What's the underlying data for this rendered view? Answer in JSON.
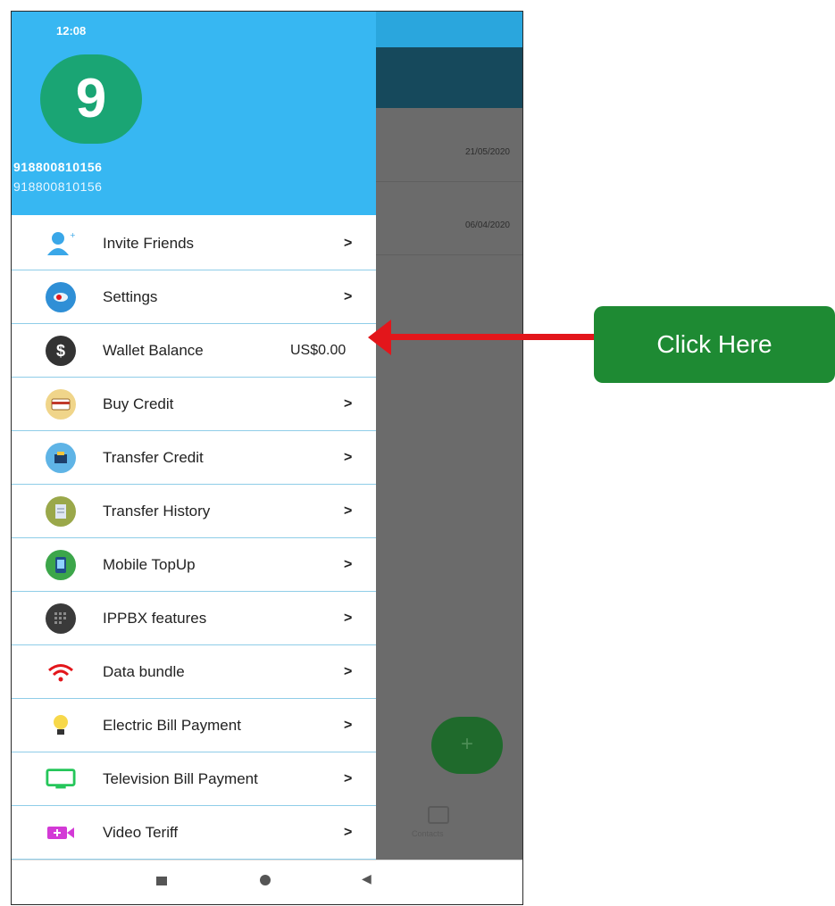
{
  "status_bar": {
    "time": "12:08",
    "icons": "⁴⁄ᵢₗ ▭"
  },
  "profile": {
    "avatar_letter": "9",
    "name": "918800810156",
    "number": "918800810156"
  },
  "background": {
    "dates": [
      "21/05/2020",
      "06/04/2020"
    ],
    "fab_icon": "+",
    "bottom_tab": "Contacts"
  },
  "menu": [
    {
      "label": "Invite Friends",
      "trail": ">",
      "icon": "add-person-icon",
      "color": "#3aa7e8"
    },
    {
      "label": "Settings",
      "trail": ">",
      "icon": "settings-icon",
      "color": "#2f8fd6"
    },
    {
      "label": "Wallet Balance",
      "trail": "US$0.00",
      "icon": "dollar-icon",
      "color": "#333333"
    },
    {
      "label": "Buy Credit",
      "trail": ">",
      "icon": "credit-card-icon",
      "color": "#c99a38"
    },
    {
      "label": "Transfer Credit",
      "trail": ">",
      "icon": "transfer-icon",
      "color": "#2a79c2"
    },
    {
      "label": "Transfer History",
      "trail": ">",
      "icon": "history-icon",
      "color": "#8a9a3a"
    },
    {
      "label": "Mobile TopUp",
      "trail": ">",
      "icon": "mobile-icon",
      "color": "#3ca64a"
    },
    {
      "label": "IPPBX features",
      "trail": ">",
      "icon": "ippbx-icon",
      "color": "#3a3a3a"
    },
    {
      "label": "Data bundle",
      "trail": ">",
      "icon": "wifi-icon",
      "color": "#e3161b"
    },
    {
      "label": "Electric Bill Payment",
      "trail": ">",
      "icon": "bulb-icon",
      "color": "#f2c53d"
    },
    {
      "label": "Television Bill Payment",
      "trail": ">",
      "icon": "tv-icon",
      "color": "#25c65a"
    },
    {
      "label": "Video Teriff",
      "trail": ">",
      "icon": "video-icon",
      "color": "#d33ad6"
    }
  ],
  "nav": {
    "square": "■",
    "circle": "●",
    "back": "◀"
  },
  "annotation": {
    "label": "Click Here"
  }
}
